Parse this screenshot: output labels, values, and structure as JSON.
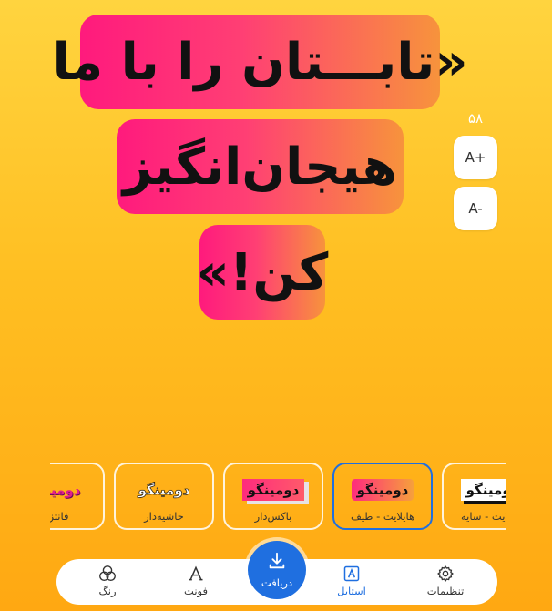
{
  "headline": {
    "line1": "«تابـــتان را با ما",
    "line2": "هیجان‌انگیز",
    "line3": "کن!»"
  },
  "font_size": {
    "value": "۵۸",
    "increase_label": "A+",
    "decrease_label": "A-"
  },
  "styles": [
    {
      "preview": "دومینگو",
      "label": "فانتزی"
    },
    {
      "preview": "دومینگو",
      "label": "حاشیه‌دار"
    },
    {
      "preview": "دومینگو",
      "label": "باکس‌دار"
    },
    {
      "preview": "دومینگو",
      "label": "هایلایت - طیف"
    },
    {
      "preview": "دومینگو",
      "label": "هایلایت - سایه"
    }
  ],
  "selected_style": "هایلایت - طیف",
  "nav": {
    "settings": "تنظیمات",
    "style": "استایل",
    "download": "دریافت",
    "font": "فونت",
    "color": "رنگ"
  },
  "colors": {
    "accent": "#1f6fe0",
    "highlight_start": "#ff1a7d",
    "highlight_end": "#f7933c",
    "background_top": "#ffd43f",
    "background_bottom": "#ffa812"
  },
  "icons": {
    "settings": "gear-icon",
    "style": "text-style-icon",
    "download": "download-icon",
    "font": "font-icon",
    "color": "color-circles-icon"
  }
}
